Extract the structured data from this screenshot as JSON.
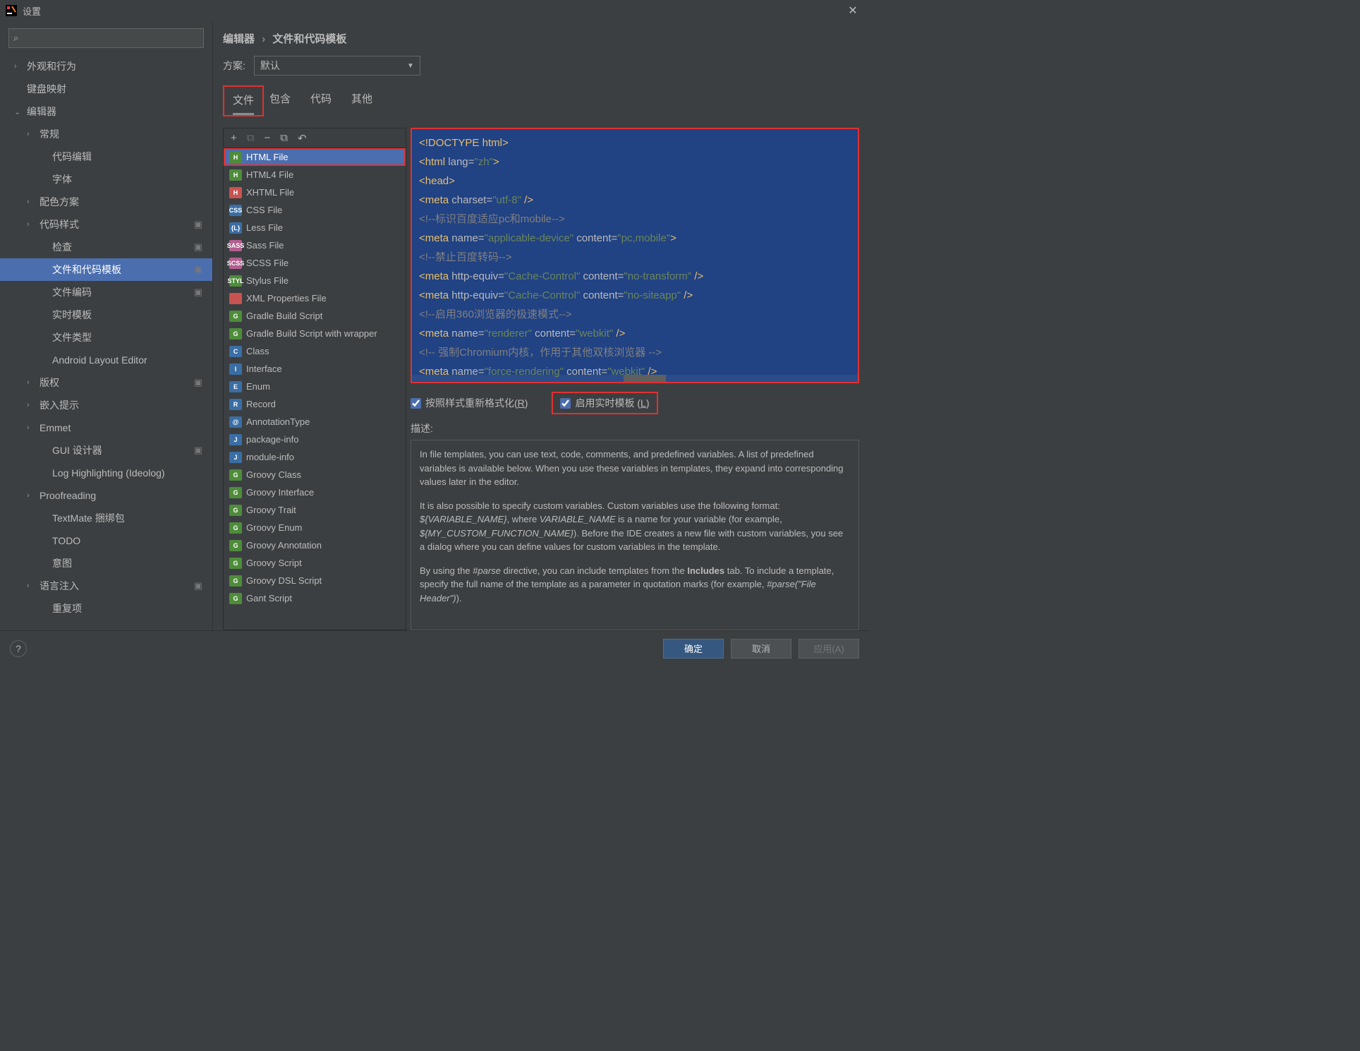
{
  "window": {
    "title": "设置"
  },
  "sidebar": {
    "items": [
      {
        "label": "外观和行为",
        "chev": "›",
        "lvl": 0
      },
      {
        "label": "键盘映射",
        "chev": "",
        "lvl": 0
      },
      {
        "label": "编辑器",
        "chev": "⌄",
        "lvl": 0
      },
      {
        "label": "常规",
        "chev": "›",
        "lvl": 1
      },
      {
        "label": "代码编辑",
        "chev": "",
        "lvl": 2
      },
      {
        "label": "字体",
        "chev": "",
        "lvl": 2
      },
      {
        "label": "配色方案",
        "chev": "›",
        "lvl": 1
      },
      {
        "label": "代码样式",
        "chev": "›",
        "lvl": 1,
        "gear": true
      },
      {
        "label": "检查",
        "chev": "",
        "lvl": 2,
        "gear": true
      },
      {
        "label": "文件和代码模板",
        "chev": "",
        "lvl": 2,
        "gear": true,
        "selected": true
      },
      {
        "label": "文件编码",
        "chev": "",
        "lvl": 2,
        "gear": true
      },
      {
        "label": "实时模板",
        "chev": "",
        "lvl": 2
      },
      {
        "label": "文件类型",
        "chev": "",
        "lvl": 2
      },
      {
        "label": "Android Layout Editor",
        "chev": "",
        "lvl": 2
      },
      {
        "label": "版权",
        "chev": "›",
        "lvl": 1,
        "gear": true
      },
      {
        "label": "嵌入提示",
        "chev": "›",
        "lvl": 1
      },
      {
        "label": "Emmet",
        "chev": "›",
        "lvl": 1
      },
      {
        "label": "GUI 设计器",
        "chev": "",
        "lvl": 2,
        "gear": true
      },
      {
        "label": "Log Highlighting (Ideolog)",
        "chev": "",
        "lvl": 2
      },
      {
        "label": "Proofreading",
        "chev": "›",
        "lvl": 1
      },
      {
        "label": "TextMate 捆绑包",
        "chev": "",
        "lvl": 2
      },
      {
        "label": "TODO",
        "chev": "",
        "lvl": 2
      },
      {
        "label": "意图",
        "chev": "",
        "lvl": 2
      },
      {
        "label": "语言注入",
        "chev": "›",
        "lvl": 1,
        "gear": true
      },
      {
        "label": "重复项",
        "chev": "",
        "lvl": 2
      }
    ]
  },
  "breadcrumb": {
    "a": "编辑器",
    "sep": "›",
    "b": "文件和代码模板"
  },
  "scheme": {
    "label": "方案:",
    "value": "默认"
  },
  "tabs": [
    "文件",
    "包含",
    "代码",
    "其他"
  ],
  "toolbar": {
    "add": "+",
    "copy_disabled": "⧉",
    "remove": "−",
    "copy": "⧉",
    "undo": "↶"
  },
  "files": [
    {
      "label": "HTML File",
      "ic": "ic-html",
      "t": "H",
      "selected": true,
      "hl": true
    },
    {
      "label": "HTML4 File",
      "ic": "ic-h4",
      "t": "H"
    },
    {
      "label": "XHTML File",
      "ic": "ic-xh",
      "t": "H"
    },
    {
      "label": "CSS File",
      "ic": "ic-css",
      "t": "CSS"
    },
    {
      "label": "Less File",
      "ic": "ic-less",
      "t": "{L}"
    },
    {
      "label": "Sass File",
      "ic": "ic-sass",
      "t": "SASS"
    },
    {
      "label": "SCSS File",
      "ic": "ic-scss",
      "t": "SCSS"
    },
    {
      "label": "Stylus File",
      "ic": "ic-styl",
      "t": "STYL"
    },
    {
      "label": "XML Properties File",
      "ic": "ic-xml",
      "t": "</>"
    },
    {
      "label": "Gradle Build Script",
      "ic": "ic-g",
      "t": "G"
    },
    {
      "label": "Gradle Build Script with wrapper",
      "ic": "ic-g",
      "t": "G"
    },
    {
      "label": "Class",
      "ic": "ic-j",
      "t": "C"
    },
    {
      "label": "Interface",
      "ic": "ic-j",
      "t": "I"
    },
    {
      "label": "Enum",
      "ic": "ic-j",
      "t": "E"
    },
    {
      "label": "Record",
      "ic": "ic-j",
      "t": "R"
    },
    {
      "label": "AnnotationType",
      "ic": "ic-j",
      "t": "@"
    },
    {
      "label": "package-info",
      "ic": "ic-j",
      "t": "J"
    },
    {
      "label": "module-info",
      "ic": "ic-j",
      "t": "J"
    },
    {
      "label": "Groovy Class",
      "ic": "ic-g",
      "t": "G"
    },
    {
      "label": "Groovy Interface",
      "ic": "ic-g",
      "t": "G"
    },
    {
      "label": "Groovy Trait",
      "ic": "ic-g",
      "t": "G"
    },
    {
      "label": "Groovy Enum",
      "ic": "ic-g",
      "t": "G"
    },
    {
      "label": "Groovy Annotation",
      "ic": "ic-g",
      "t": "G"
    },
    {
      "label": "Groovy Script",
      "ic": "ic-g",
      "t": "G"
    },
    {
      "label": "Groovy DSL Script",
      "ic": "ic-g",
      "t": "G"
    },
    {
      "label": "Gant Script",
      "ic": "ic-g",
      "t": "G"
    }
  ],
  "code_lines": [
    [
      [
        "tag",
        "<!DOCTYPE html>"
      ]
    ],
    [
      [
        "tag",
        "<html "
      ],
      [
        "attr",
        "lang="
      ],
      [
        "str",
        "\"zh\""
      ],
      [
        "tag",
        ">"
      ]
    ],
    [
      [
        "tag",
        "<head>"
      ]
    ],
    [
      [
        "pad",
        "  "
      ],
      [
        "tag",
        "<meta "
      ],
      [
        "attr",
        "charset="
      ],
      [
        "str",
        "\"utf-8\""
      ],
      [
        "tag",
        " />"
      ]
    ],
    [
      [
        "pad",
        "  "
      ],
      [
        "cm",
        "<!--标识百度适应pc和mobile-->"
      ]
    ],
    [
      [
        "pad",
        "  "
      ],
      [
        "tag",
        "<meta "
      ],
      [
        "attr",
        "name="
      ],
      [
        "str",
        "\"applicable-device\""
      ],
      [
        "attr",
        " content="
      ],
      [
        "str",
        "\"pc,mobile\""
      ],
      [
        "tag",
        ">"
      ]
    ],
    [
      [
        "pad",
        "  "
      ],
      [
        "cm",
        "<!--禁止百度转码-->"
      ]
    ],
    [
      [
        "pad",
        "  "
      ],
      [
        "tag",
        "<meta "
      ],
      [
        "attr",
        "http-equiv="
      ],
      [
        "str",
        "\"Cache-Control\""
      ],
      [
        "attr",
        " content="
      ],
      [
        "str",
        "\"no-transform\""
      ],
      [
        "tag",
        " />"
      ]
    ],
    [
      [
        "pad",
        "  "
      ],
      [
        "tag",
        "<meta "
      ],
      [
        "attr",
        "http-equiv="
      ],
      [
        "str",
        "\"Cache-Control\""
      ],
      [
        "attr",
        " content="
      ],
      [
        "str",
        "\"no-siteapp\""
      ],
      [
        "tag",
        " />"
      ]
    ],
    [
      [
        "pad",
        "  "
      ],
      [
        "cm",
        "<!--启用360浏览器的极速模式-->"
      ]
    ],
    [
      [
        "pad",
        "  "
      ],
      [
        "tag",
        "<meta "
      ],
      [
        "attr",
        "name="
      ],
      [
        "str",
        "\"renderer\""
      ],
      [
        "attr",
        " content="
      ],
      [
        "str",
        "\"webkit\""
      ],
      [
        "tag",
        " />"
      ]
    ],
    [
      [
        "pad",
        "  "
      ],
      [
        "cm",
        "<!-- 强制Chromium内核，作用于其他双核浏览器 -->"
      ]
    ],
    [
      [
        "pad",
        "  "
      ],
      [
        "tag",
        "<meta "
      ],
      [
        "attr",
        "name="
      ],
      [
        "str",
        "\"force-rendering\""
      ],
      [
        "attr",
        " content="
      ],
      [
        "str",
        "\"webkit\""
      ],
      [
        "tag",
        " />"
      ]
    ]
  ],
  "checks": {
    "reformat": "按照样式重新格式化(R)",
    "reformat_u": "R",
    "live": "启用实时模板 (L)",
    "live_u": "L"
  },
  "desc": {
    "label": "描述:",
    "p1a": "In file templates, you can use text, code, comments, and predefined variables. A list of predefined variables is available below. When you use these variables in templates, they expand into corresponding values later in the editor.",
    "p2a": "It is also possible to specify custom variables. Custom variables use the following format: ",
    "p2b": "${VARIABLE_NAME}",
    "p2c": ", where ",
    "p2d": "VARIABLE_NAME",
    "p2e": " is a name for your variable (for example, ",
    "p2f": "${MY_CUSTOM_FUNCTION_NAME}",
    "p2g": "). Before the IDE creates a new file with custom variables, you see a dialog where you can define values for custom variables in the template.",
    "p3a": "By using the ",
    "p3b": "#parse",
    "p3c": " directive, you can include templates from the ",
    "p3d": "Includes",
    "p3e": " tab. To include a template, specify the full name of the template as a parameter in quotation marks (for example, ",
    "p3f": "#parse(\"File Header\")",
    "p3g": ")."
  },
  "footer": {
    "ok": "确定",
    "cancel": "取消",
    "apply": "应用(A)"
  }
}
